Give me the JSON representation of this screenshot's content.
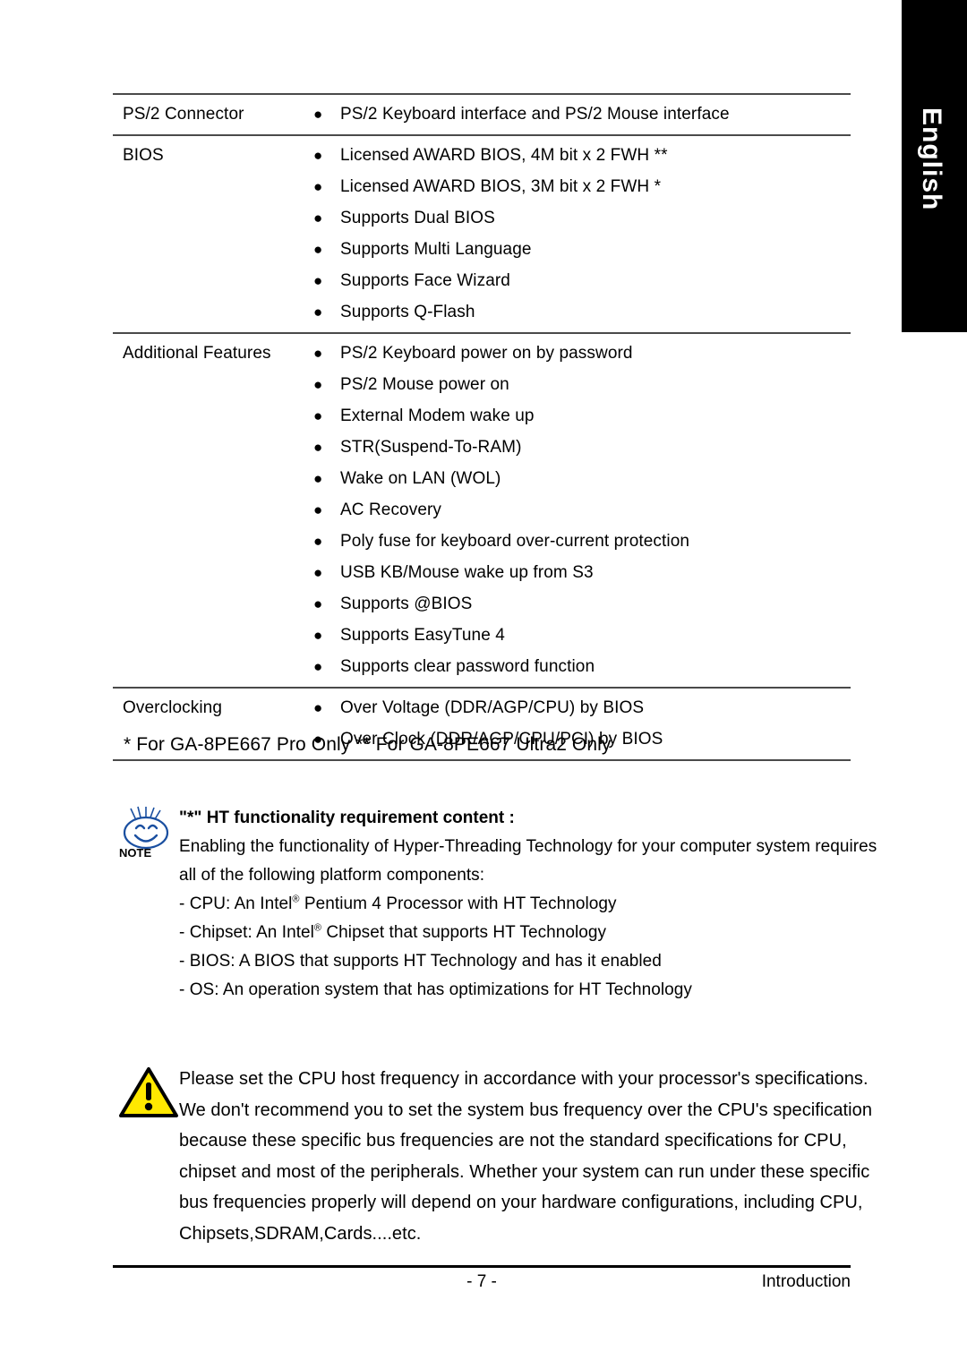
{
  "language_tab": {
    "label": "English"
  },
  "spec_table": {
    "rows": [
      {
        "label": "PS/2 Connector",
        "items": [
          "PS/2 Keyboard interface and PS/2 Mouse interface"
        ]
      },
      {
        "label": "BIOS",
        "items": [
          "Licensed AWARD BIOS, 4M bit x 2 FWH **",
          "Licensed AWARD BIOS, 3M bit x 2 FWH *",
          "Supports Dual BIOS",
          "Supports Multi Language",
          "Supports Face Wizard",
          "Supports Q-Flash"
        ]
      },
      {
        "label": "Additional Features",
        "items": [
          "PS/2 Keyboard power on by password",
          "PS/2 Mouse power on",
          "External Modem wake up",
          "STR(Suspend-To-RAM)",
          "Wake on LAN (WOL)",
          "AC Recovery",
          "Poly fuse for keyboard over-current protection",
          "USB KB/Mouse wake up from S3",
          "Supports @BIOS",
          "Supports EasyTune 4",
          "Supports clear password function"
        ]
      },
      {
        "label": "Overclocking",
        "items": [
          "Over Voltage (DDR/AGP/CPU) by BIOS",
          "Over Clock (DDR/AGP/CPU/PCI) by BIOS"
        ]
      }
    ],
    "bullet_glyph": "●"
  },
  "table_footnote": "*  For GA-8PE667 Pro Only  **  For GA-8PE667 Ultra2 Only",
  "note": {
    "icon_label": "NOTE",
    "heading": "\"*\" HT functionality requirement content :",
    "lines": [
      "Enabling the functionality of Hyper-Threading Technology for your computer system requires",
      "all of the following platform components:"
    ],
    "bullets": [
      {
        "prefix": "- CPU: An Intel",
        "reg": "®",
        "suffix": " Pentium 4 Processor with HT Technology"
      },
      {
        "prefix": "- Chipset: An Intel",
        "reg": "®",
        "suffix": " Chipset that supports HT Technology"
      },
      {
        "prefix": "- BIOS: A BIOS that supports HT Technology and has it enabled",
        "reg": "",
        "suffix": ""
      },
      {
        "prefix": "- OS: An operation system that has optimizations for HT Technology",
        "reg": "",
        "suffix": ""
      }
    ]
  },
  "warning": {
    "lines": [
      "Please set the CPU host frequency in accordance with your processor's  specifications.",
      "We don't recommend you to set the system bus frequency over the CPU's specification",
      "because these specific bus frequencies are not the standard specifications for CPU,",
      "chipset and most of the peripherals. Whether your system can run under  these specific",
      "bus frequencies properly will depend on your hardware configurations, including CPU,",
      "Chipsets,SDRAM,Cards....etc."
    ],
    "icon_color": "#FFE800"
  },
  "footer": {
    "page_number": "- 7 -",
    "section": "Introduction"
  }
}
